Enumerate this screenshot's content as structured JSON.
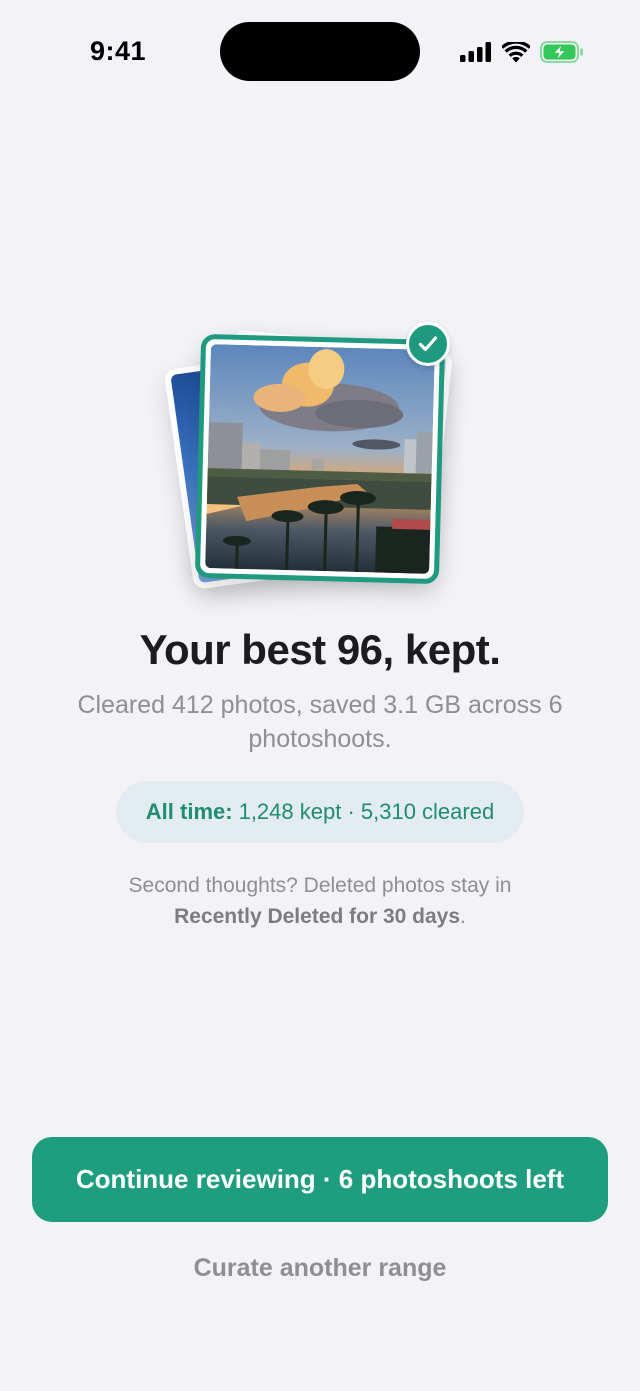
{
  "status_bar": {
    "time": "9:41",
    "icons": [
      "cellular-signal-icon",
      "wifi-icon",
      "battery-charging-icon"
    ],
    "battery_color": "#34c759"
  },
  "hero": {
    "photo_description": "sunset-city-canal-photo",
    "badge_icon": "checkmark-icon",
    "accent_color": "#1f9a7e"
  },
  "summary": {
    "headline": "Your best 96, kept.",
    "subline": "Cleared 412 photos, saved 3.1 GB across 6 photoshoots."
  },
  "all_time": {
    "label": "All time:",
    "value": "1,248 kept · 5,310 cleared"
  },
  "note": {
    "prefix": "Second thoughts? Deleted photos stay in",
    "emphasis": "Recently Deleted for 30 days",
    "suffix": "."
  },
  "actions": {
    "primary_label": "Continue reviewing · 6 photoshoots left",
    "secondary_label": "Curate another range",
    "primary_color": "#1f9e7f"
  }
}
